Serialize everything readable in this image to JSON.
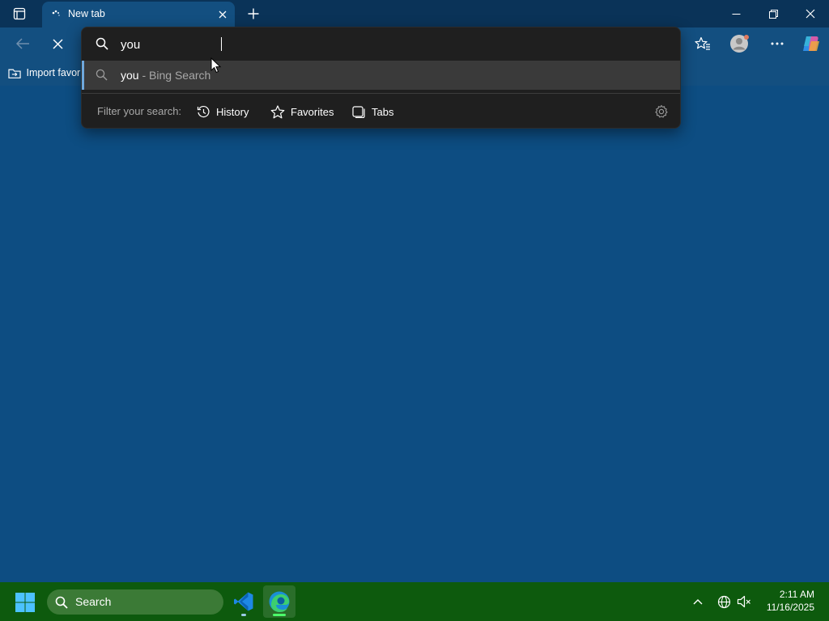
{
  "browser": {
    "tab": {
      "title": "New tab"
    },
    "favorites_bar": {
      "import_label": "Import favori"
    }
  },
  "omnibox": {
    "input_value": "you",
    "suggestion": {
      "query": "you",
      "separator": " - ",
      "engine": "Bing Search"
    },
    "filter": {
      "label": "Filter your search:",
      "chips": [
        {
          "label": "History",
          "icon": "history-icon"
        },
        {
          "label": "Favorites",
          "icon": "star-icon"
        },
        {
          "label": "Tabs",
          "icon": "tabs-icon"
        }
      ]
    }
  },
  "taskbar": {
    "search_label": "Search",
    "clock": {
      "time": "2:11 AM",
      "date": "11/16/2025"
    }
  },
  "colors": {
    "page_background": "#0d4d82",
    "toolbar": "#134f80",
    "titlebar": "#0a3358",
    "dropdown": "#1f1f1f",
    "taskbar": "#0d5a0d",
    "accent": "#6fa8dc"
  }
}
